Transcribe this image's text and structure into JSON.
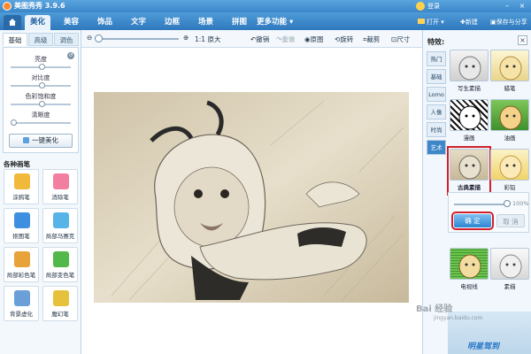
{
  "window": {
    "title": "美图秀秀 3.9.6",
    "user": "登录",
    "minimize": "–",
    "close": "×"
  },
  "tabs": {
    "home_icon": "home-icon",
    "items": [
      {
        "label": "美化",
        "active": true
      },
      {
        "label": "美容"
      },
      {
        "label": "饰品"
      },
      {
        "label": "文字"
      },
      {
        "label": "边框"
      },
      {
        "label": "场景"
      },
      {
        "label": "拼图"
      },
      {
        "label": "更多功能 ▾"
      }
    ],
    "open": "打开 ▾",
    "new": "新建",
    "save": "保存与分享"
  },
  "toolbar": {
    "zoom_original": "1:1 原大",
    "undo": "撤销",
    "redo": "重做",
    "original": "原图",
    "rotate": "旋转",
    "crop": "裁剪",
    "resize": "尺寸"
  },
  "left_panel": {
    "subtabs": [
      "基础",
      "高级",
      "调色"
    ],
    "adjustments": [
      {
        "label": "亮度",
        "level": 0.5
      },
      {
        "label": "对比度",
        "level": 0.5
      },
      {
        "label": "色彩饱和度",
        "level": 0.5
      },
      {
        "label": "清晰度",
        "level": 0.0
      }
    ],
    "one_key": "一键美化",
    "brushes_title": "各种画笔",
    "brushes": [
      {
        "label": "涂鸦笔",
        "color": "#f1b93a"
      },
      {
        "label": "消除笔",
        "color": "#f27fa0"
      },
      {
        "label": "抠图笔",
        "color": "#3f8fe0"
      },
      {
        "label": "局部马赛克",
        "color": "#58b4e6"
      },
      {
        "label": "局部彩色笔",
        "color": "#e8a23a"
      },
      {
        "label": "局部变色笔",
        "color": "#52b84a"
      },
      {
        "label": "背景虚化",
        "color": "#6a9fd8"
      },
      {
        "label": "魔幻笔",
        "color": "#e6c23c"
      }
    ]
  },
  "right_panel": {
    "title": "特效:",
    "close": "×",
    "categories": [
      {
        "label": "热门"
      },
      {
        "label": "基础"
      },
      {
        "label": "Lomo"
      },
      {
        "label": "人像"
      },
      {
        "label": "时尚"
      },
      {
        "label": "艺术",
        "active": true
      }
    ],
    "effects": [
      {
        "label": "写生素描"
      },
      {
        "label": "蜡笔"
      },
      {
        "label": "漫画"
      },
      {
        "label": "油画"
      },
      {
        "label": "古典素描",
        "selected": true
      },
      {
        "label": "彩铅"
      },
      {
        "label": "电视线"
      },
      {
        "label": "素描"
      }
    ],
    "opacity": "100%",
    "opacity_level": 1.0,
    "ok": "确 定",
    "cancel": "取 消",
    "promo": "明星驾到"
  },
  "watermark": {
    "main": "Bai 经验",
    "sub": "jingyan.baidu.com"
  }
}
